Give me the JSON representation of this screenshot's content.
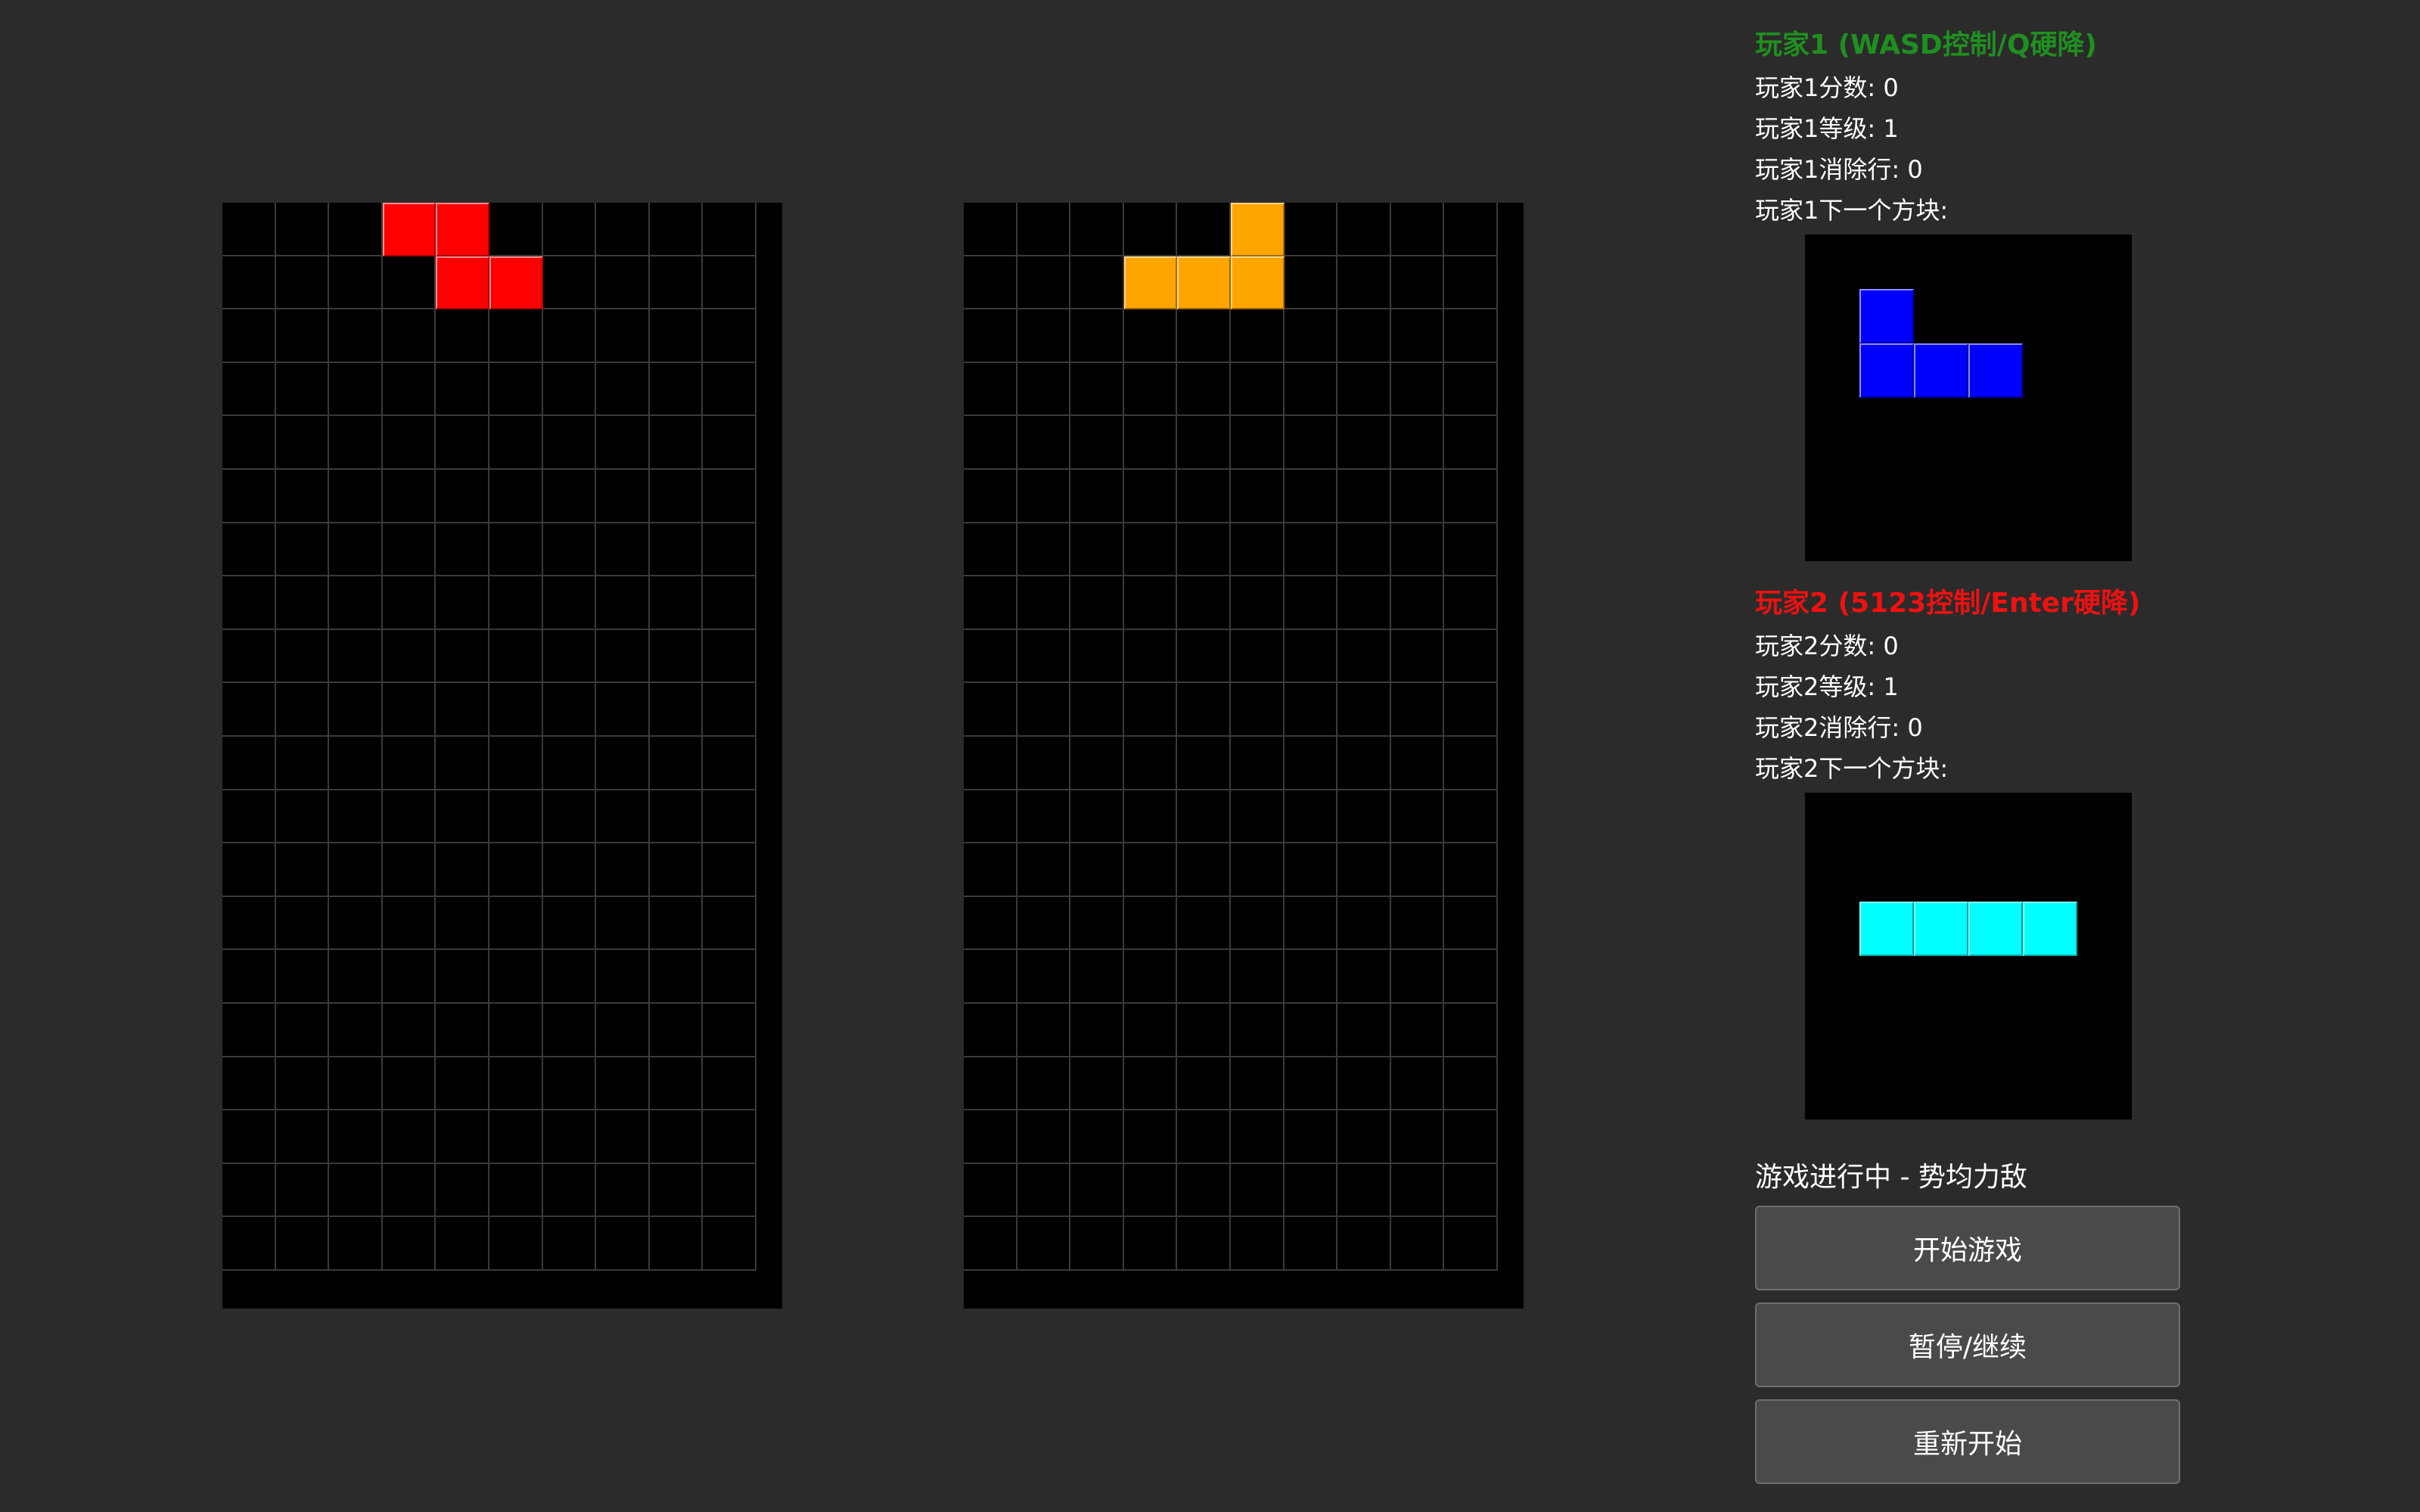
{
  "colors": {
    "background": "#2b2b2b",
    "board": "#000000",
    "grid_line": "#3a3a3a",
    "player1_title": "#1f8f1f",
    "player2_title": "#ee1111",
    "button_bg": "#4a4a4a"
  },
  "game": {
    "board_cols": 10,
    "board_rows": 20,
    "preview_cols": 6,
    "preview_rows": 6
  },
  "player1": {
    "title": "玩家1 (WASD控制/Q硬降)",
    "score_label": "玩家1分数: 0",
    "level_label": "玩家1等级: 1",
    "lines_label": "玩家1消除行: 0",
    "next_label": "玩家1下一个方块:",
    "active_piece": {
      "name": "Z",
      "color": "#ff0000",
      "cells": [
        [
          3,
          0
        ],
        [
          4,
          0
        ],
        [
          4,
          1
        ],
        [
          5,
          1
        ]
      ]
    },
    "next_piece": {
      "name": "J",
      "color": "#0000ff",
      "cells": [
        [
          1,
          1
        ],
        [
          1,
          2
        ],
        [
          2,
          2
        ],
        [
          3,
          2
        ]
      ]
    }
  },
  "player2": {
    "title": "玩家2 (5123控制/Enter硬降)",
    "score_label": "玩家2分数: 0",
    "level_label": "玩家2等级: 1",
    "lines_label": "玩家2消除行: 0",
    "next_label": "玩家2下一个方块:",
    "active_piece": {
      "name": "L",
      "color": "#ffa500",
      "cells": [
        [
          5,
          0
        ],
        [
          3,
          1
        ],
        [
          4,
          1
        ],
        [
          5,
          1
        ]
      ]
    },
    "next_piece": {
      "name": "I",
      "color": "#00ffff",
      "cells": [
        [
          1,
          2
        ],
        [
          2,
          2
        ],
        [
          3,
          2
        ],
        [
          4,
          2
        ]
      ]
    }
  },
  "status": "游戏进行中 - 势均力敌",
  "buttons": {
    "start": "开始游戏",
    "pause": "暂停/继续",
    "restart": "重新开始"
  }
}
